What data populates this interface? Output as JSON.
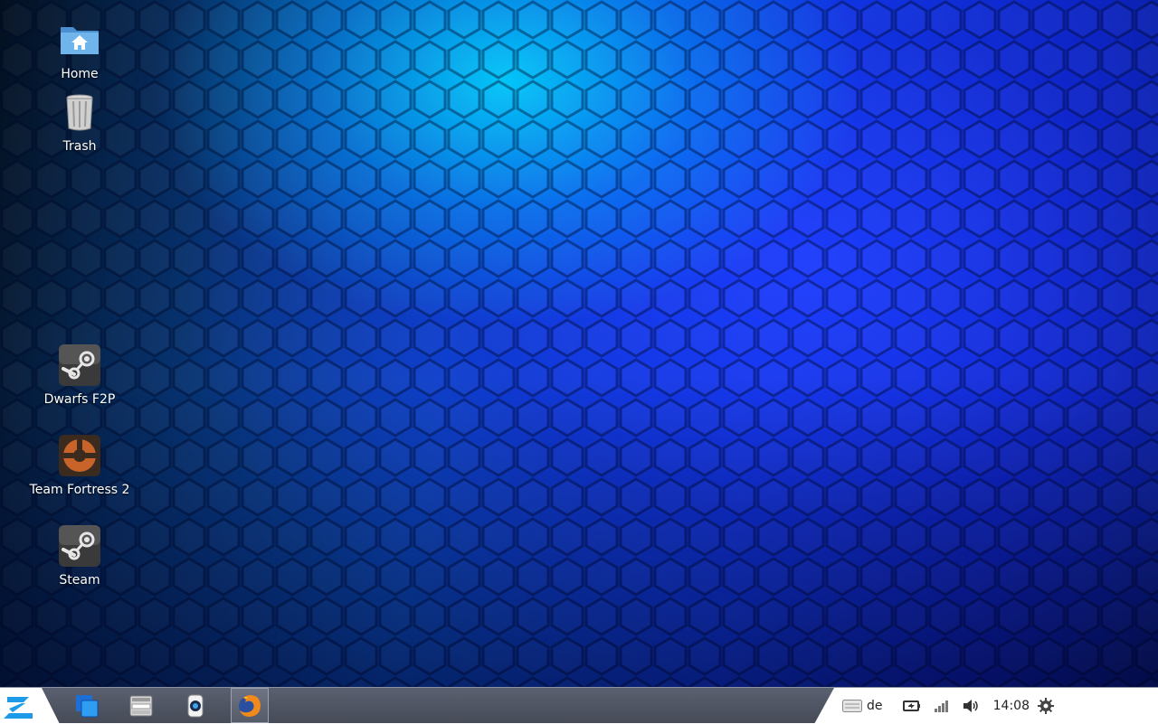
{
  "desktop": {
    "icons": [
      {
        "label": "Home",
        "icon": "home-folder-icon"
      },
      {
        "label": "Trash",
        "icon": "trash-icon"
      },
      {
        "label": "Dwarfs F2P",
        "icon": "steam-icon"
      },
      {
        "label": "Team Fortress 2",
        "icon": "tf2-icon"
      },
      {
        "label": "Steam",
        "icon": "steam-icon"
      }
    ]
  },
  "taskbar": {
    "start_icon": "zorin-logo-icon",
    "launchers": [
      {
        "icon": "workspace-switcher-icon",
        "active": false
      },
      {
        "icon": "file-manager-icon",
        "active": false
      },
      {
        "icon": "software-center-icon",
        "active": false
      },
      {
        "icon": "firefox-icon",
        "active": true
      }
    ],
    "tray": {
      "keyboard_layout": "de",
      "clock": "14:08",
      "icons": [
        "keyboard-icon",
        "battery-icon",
        "network-signal-icon",
        "volume-icon",
        "settings-gear-icon"
      ]
    }
  },
  "colors": {
    "taskbar_bg": "#4f5562",
    "accent": "#1e9be8",
    "desktop_blue": "#0d3ee8"
  }
}
